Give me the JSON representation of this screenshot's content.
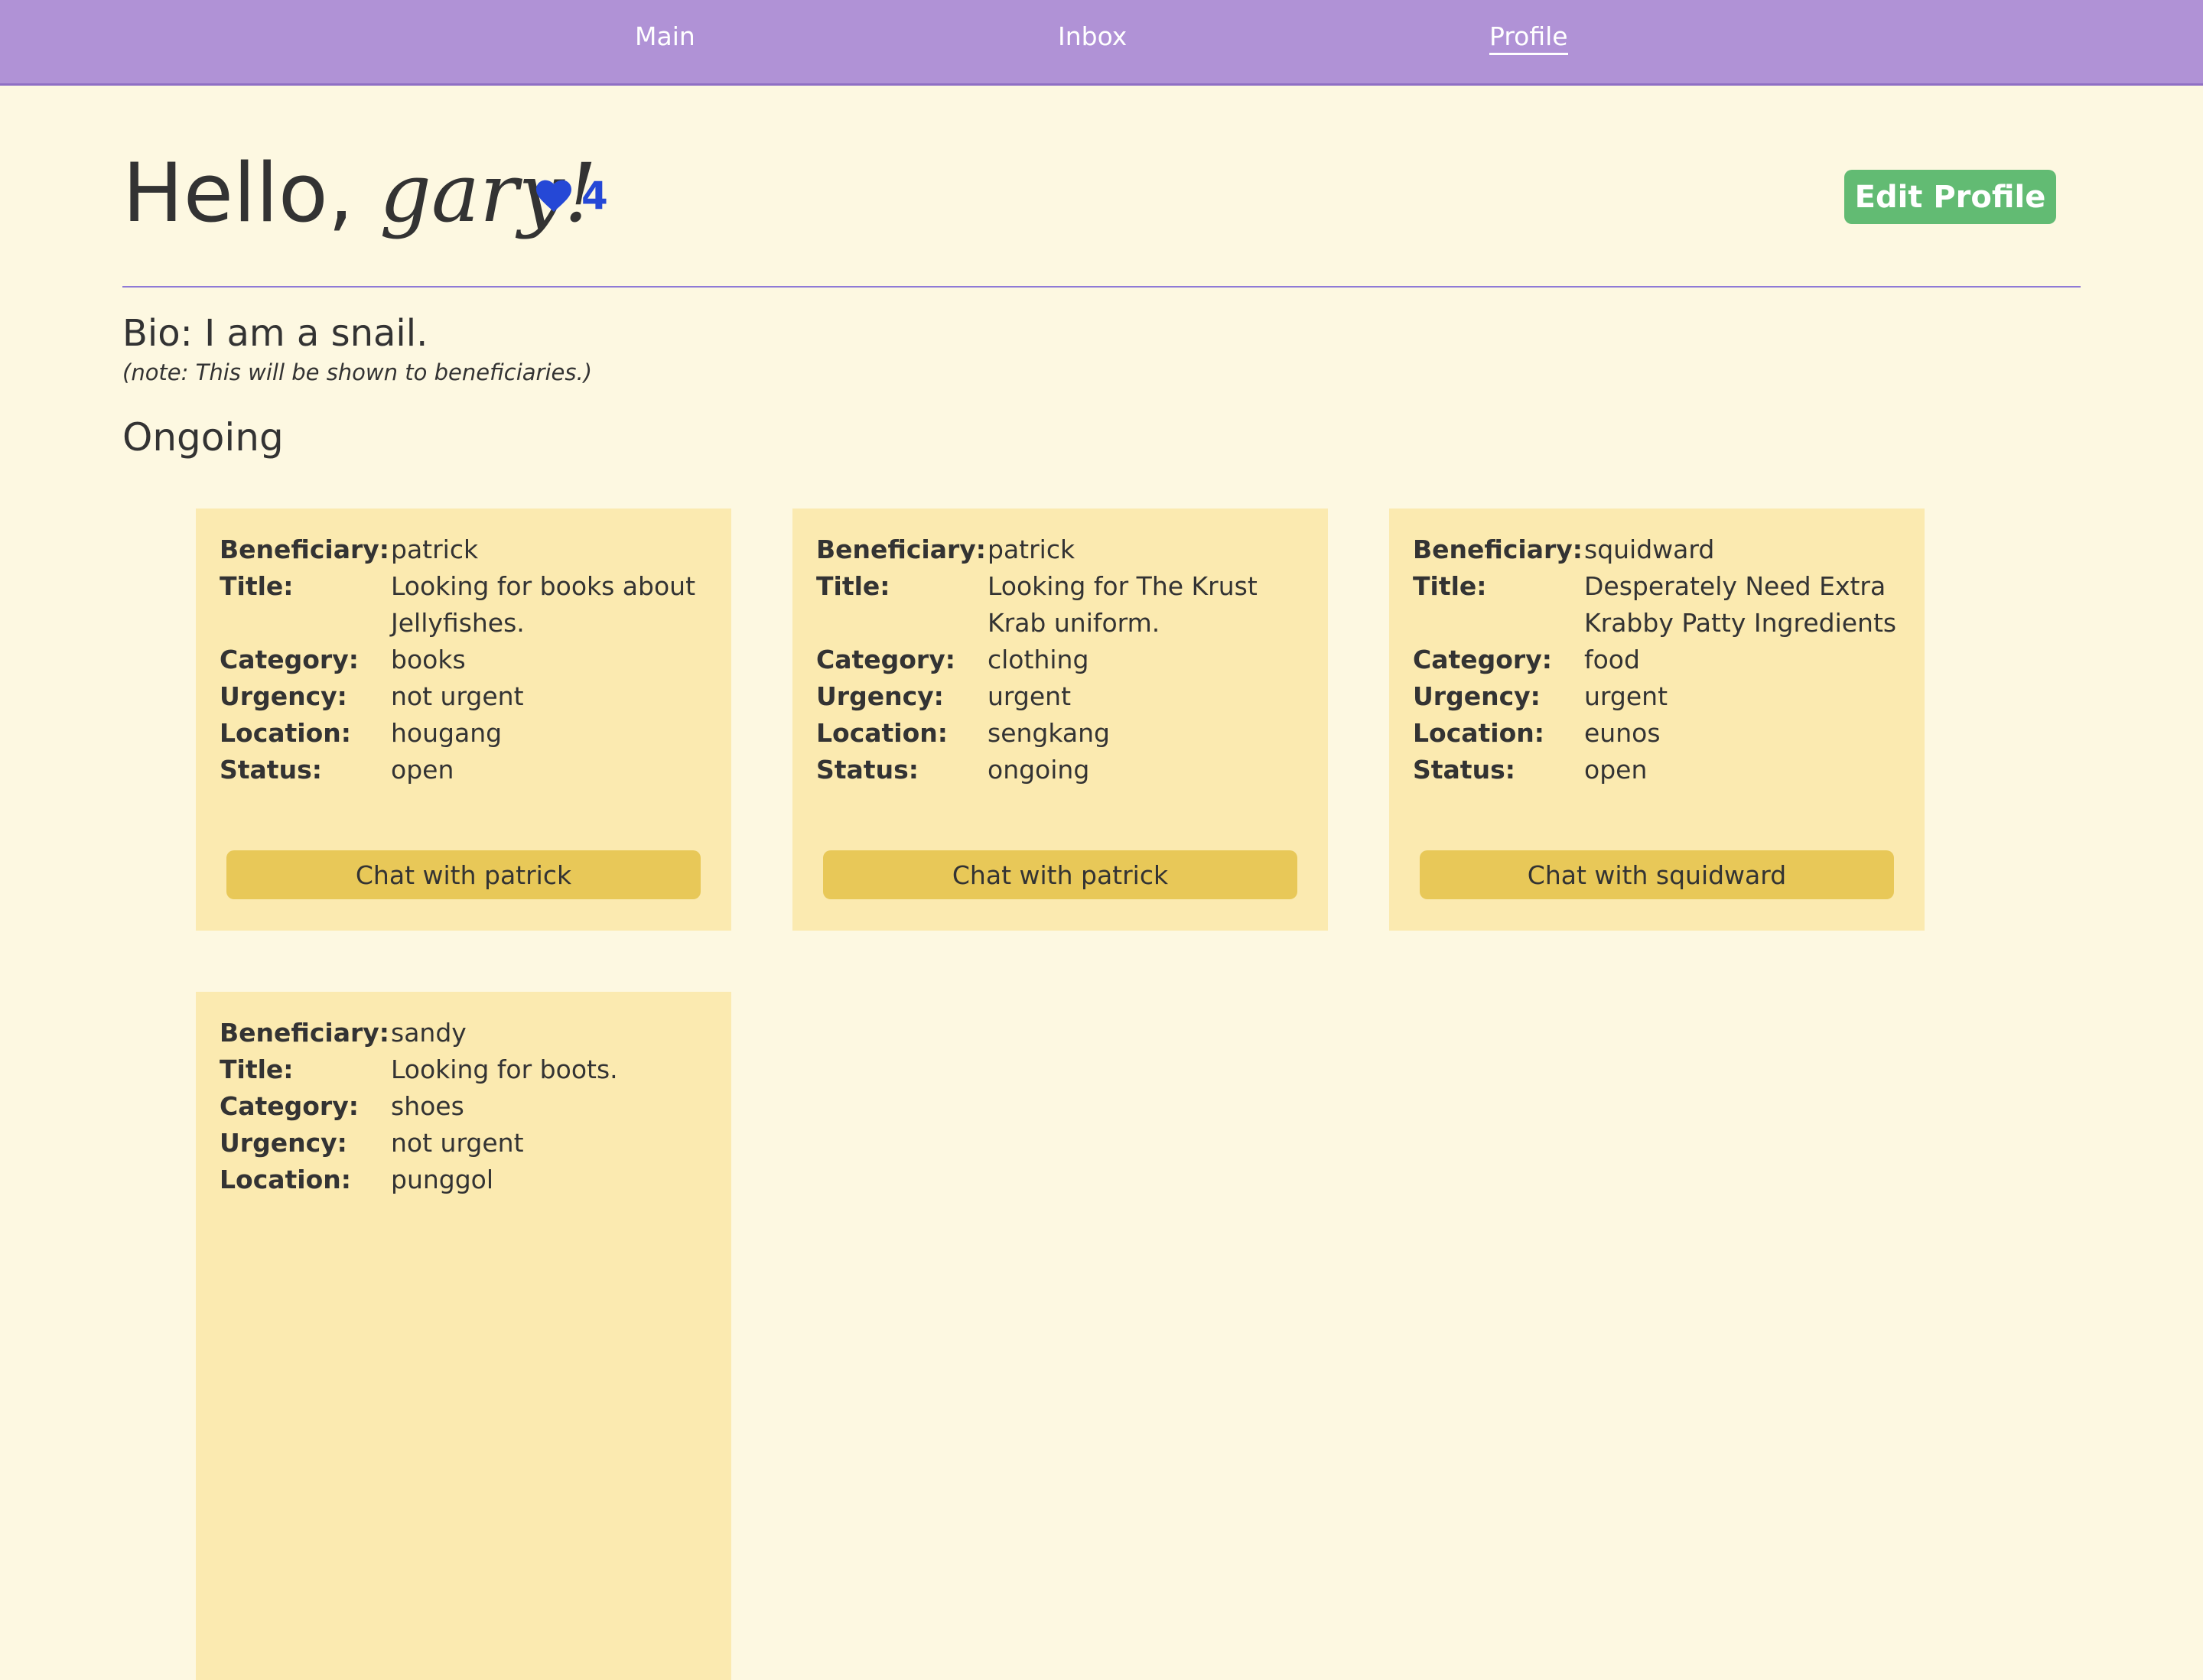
{
  "nav": {
    "main": "Main",
    "inbox": "Inbox",
    "profile": "Profile"
  },
  "header": {
    "greeting": "Hello, ",
    "name": "gary!",
    "likes_count": "4",
    "edit_button": "Edit Profile",
    "heart_icon": "heart-icon",
    "colors": {
      "nav_bg": "#b092d6",
      "page_bg": "#fdf8e1",
      "card_bg": "#fbeab0",
      "chat_button": "#e8c858",
      "edit_button": "#62bb73",
      "heart": "#2548d6"
    }
  },
  "bio": {
    "text": "Bio: I am a snail.",
    "note": "(note: This will be shown to beneficiaries.)"
  },
  "section": {
    "title": "Ongoing"
  },
  "labels": {
    "beneficiary": "Beneficiary:",
    "title": "Title:",
    "category": "Category:",
    "urgency": "Urgency:",
    "location": "Location:",
    "status": "Status:"
  },
  "cards": [
    {
      "beneficiary": "patrick",
      "title": "Looking for books about Jellyfishes.",
      "category": "books",
      "urgency": "not urgent",
      "location": "hougang",
      "status": "open",
      "chat_label": "Chat with patrick"
    },
    {
      "beneficiary": "patrick",
      "title": "Looking for The Krust Krab uniform.",
      "category": "clothing",
      "urgency": "urgent",
      "location": "sengkang",
      "status": "ongoing",
      "chat_label": "Chat with patrick"
    },
    {
      "beneficiary": "squidward",
      "title": "Desperately Need Extra Krabby Patty Ingredients",
      "category": "food",
      "urgency": "urgent",
      "location": "eunos",
      "status": "open",
      "chat_label": "Chat with squidward"
    },
    {
      "beneficiary": "sandy",
      "title": "Looking for boots.",
      "category": "shoes",
      "urgency": "not urgent",
      "location": "punggol"
    }
  ]
}
